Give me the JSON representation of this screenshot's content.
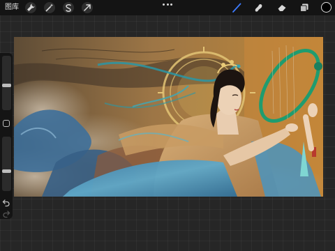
{
  "app": {
    "gallery_label": "图库"
  },
  "toolbar_left": [
    {
      "name": "actions-wrench-icon"
    },
    {
      "name": "adjustments-wand-icon"
    },
    {
      "name": "selection-s-icon"
    },
    {
      "name": "transform-arrow-icon"
    }
  ],
  "toolbar_right": {
    "tools": [
      "brush-icon",
      "smudge-icon",
      "eraser-icon",
      "layers-icon"
    ],
    "active_tool": "brush-icon",
    "active_color": "#000000"
  },
  "colors": {
    "accent_brush": "#3d7bff",
    "toolbar_bg": "#141414",
    "workspace_bg": "#262626"
  },
  "sidebar": {
    "brush_size_level": 0.45,
    "opacity_level": 0.35
  }
}
